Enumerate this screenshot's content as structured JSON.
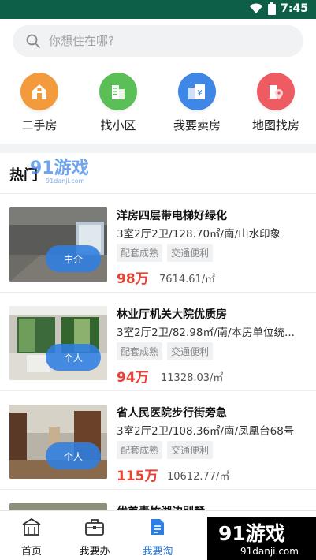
{
  "status_bar": {
    "time": "7:45",
    "wifi_icon": "wifi-icon",
    "battery_icon": "battery-icon"
  },
  "search": {
    "placeholder": "你想住在哪?",
    "icon": "search-icon"
  },
  "quick_actions": [
    {
      "label": "二手房",
      "icon": "house-icon",
      "color": "#f39a3d"
    },
    {
      "label": "找小区",
      "icon": "building-icon",
      "color": "#5bbf58"
    },
    {
      "label": "我要卖房",
      "icon": "sell-house-icon",
      "color": "#3e87e6"
    },
    {
      "label": "地图找房",
      "icon": "map-pin-icon",
      "color": "#ef5b62"
    }
  ],
  "hot_section": {
    "title": "热门"
  },
  "watermark": {
    "small_text": "91游戏",
    "small_url": "91danji.com",
    "big_text": "91游戏",
    "big_url": "91danji.com"
  },
  "listings": [
    {
      "title": "洋房四层带电梯好绿化",
      "desc": "3室2厅2卫/128.70㎡/南/山水印象",
      "tags": [
        "配套成熟",
        "交通便利"
      ],
      "price": "98万",
      "unit_price": "7614.61/㎡",
      "badge": "中介"
    },
    {
      "title": "林业厅机关大院优质房",
      "desc": " 3室2厅2卫/82.98㎡/南/本房单位统...",
      "tags": [
        "配套成熟",
        "交通便利"
      ],
      "price": "94万",
      "unit_price": "11328.03/㎡",
      "badge": "个人"
    },
    {
      "title": "省人民医院步行街旁急",
      "desc": "3室2厅2卫/108.36㎡/南/凤凰台68号",
      "tags": [
        "配套成熟",
        "交通便利"
      ],
      "price": "115万",
      "unit_price": "10612.77/㎡",
      "badge": "个人"
    },
    {
      "title": "优美青竹湖边别墅",
      "desc": "",
      "tags": [],
      "price": "",
      "unit_price": "",
      "badge": ""
    }
  ],
  "bottom_nav": [
    {
      "label": "首页",
      "icon": "home-icon",
      "active": false
    },
    {
      "label": "我要办",
      "icon": "briefcase-icon",
      "active": false
    },
    {
      "label": "我要淘",
      "icon": "document-icon",
      "active": true
    }
  ],
  "colors": {
    "status_bar": "#0d6047",
    "accent": "#2f7ee1",
    "price": "#ea4335"
  }
}
